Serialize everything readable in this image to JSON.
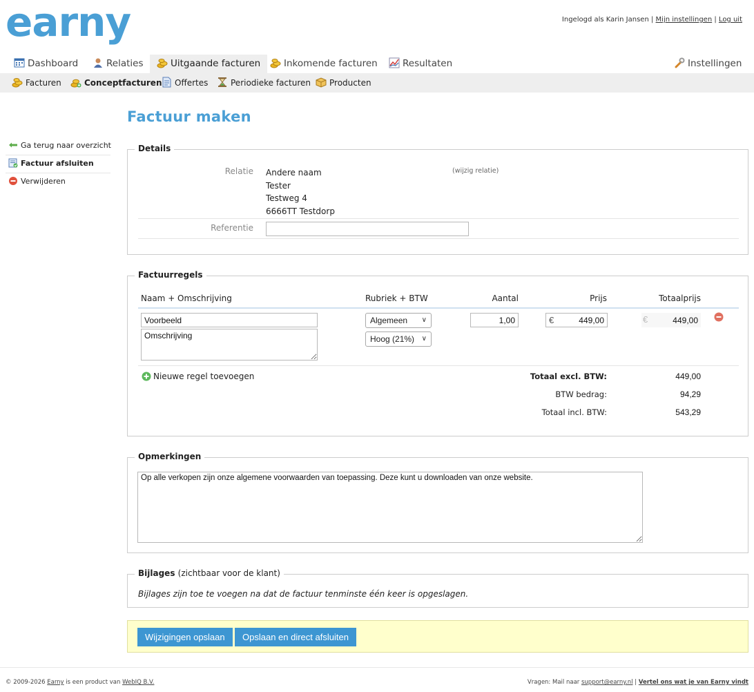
{
  "brand": {
    "logo_text": "earny",
    "color": "#4a9fd5"
  },
  "user": {
    "logged_in_prefix": "Ingelogd als Karin Jansen",
    "separator": "|",
    "settings_link": "Mijn instellingen",
    "logout_link": "Log uit"
  },
  "mainnav": {
    "tabs": [
      {
        "label": "Dashboard",
        "icon": "calendar-icon"
      },
      {
        "label": "Relaties",
        "icon": "user-icon"
      },
      {
        "label": "Uitgaande facturen",
        "icon": "coins-icon",
        "active": true
      },
      {
        "label": "Inkomende facturen",
        "icon": "coins-icon"
      },
      {
        "label": "Resultaten",
        "icon": "chart-icon"
      }
    ],
    "settings": {
      "label": "Instellingen",
      "icon": "wrench-icon"
    }
  },
  "subnav": {
    "items": [
      {
        "label": "Facturen",
        "icon": "coins-icon"
      },
      {
        "label": "Conceptfacturen",
        "icon": "coins-add-icon",
        "active": true
      },
      {
        "label": "Offertes",
        "icon": "document-icon"
      },
      {
        "label": "Periodieke facturen",
        "icon": "hourglass-icon"
      },
      {
        "label": "Producten",
        "icon": "box-icon"
      }
    ]
  },
  "sidebar": {
    "items": [
      {
        "label": "Ga terug naar overzicht",
        "icon": "arrow-left-icon"
      },
      {
        "label": "Factuur afsluiten",
        "icon": "invoice-check-icon"
      },
      {
        "label": "Verwijderen",
        "icon": "delete-icon"
      }
    ]
  },
  "page": {
    "title": "Factuur maken"
  },
  "details": {
    "legend": "Details",
    "relatie_label": "Relatie",
    "relatie_lines": [
      "Andere naam",
      "Tester",
      "Testweg 4",
      "6666TT Testdorp"
    ],
    "change_relatie": "(wijzig relatie)",
    "referentie_label": "Referentie",
    "referentie_value": ""
  },
  "lines": {
    "legend": "Factuurregels",
    "headers": {
      "name": "Naam + Omschrijving",
      "rubriek": "Rubriek + BTW",
      "aantal": "Aantal",
      "prijs": "Prijs",
      "totaal": "Totaalprijs"
    },
    "row": {
      "name": "Voorbeeld",
      "description": "Omschrijving",
      "rubriek": "Algemeen",
      "btw": "Hoog (21%)",
      "aantal": "1,00",
      "currency": "€",
      "prijs": "449,00",
      "totaal": "449,00"
    },
    "add_line": "Nieuwe regel toevoegen",
    "totals": {
      "excl_label": "Totaal excl. BTW:",
      "excl_value": "449,00",
      "btw_label": "BTW bedrag:",
      "btw_value": "94,29",
      "incl_label": "Totaal incl. BTW:",
      "incl_value": "543,29"
    }
  },
  "remarks": {
    "legend": "Opmerkingen",
    "text": "Op alle verkopen zijn onze algemene voorwaarden van toepassing. Deze kunt u downloaden van onze website."
  },
  "attachments": {
    "legend": "Bijlages",
    "legend_note": "(zichtbaar voor de klant)",
    "message": "Bijlages zijn toe te voegen na dat de factuur tenminste één keer is opgeslagen."
  },
  "actions": {
    "save": "Wijzigingen opslaan",
    "save_close": "Opslaan en direct afsluiten"
  },
  "footer": {
    "copyright": "© 2009-2026",
    "brand": "Earny",
    "product_of": "is een product van",
    "company": "WebIQ B.V.",
    "question_prefix": "Vragen: Mail naar",
    "email": "support@earny.nl",
    "separator": "|",
    "feedback": "Vertel ons wat je van Earny vindt"
  }
}
